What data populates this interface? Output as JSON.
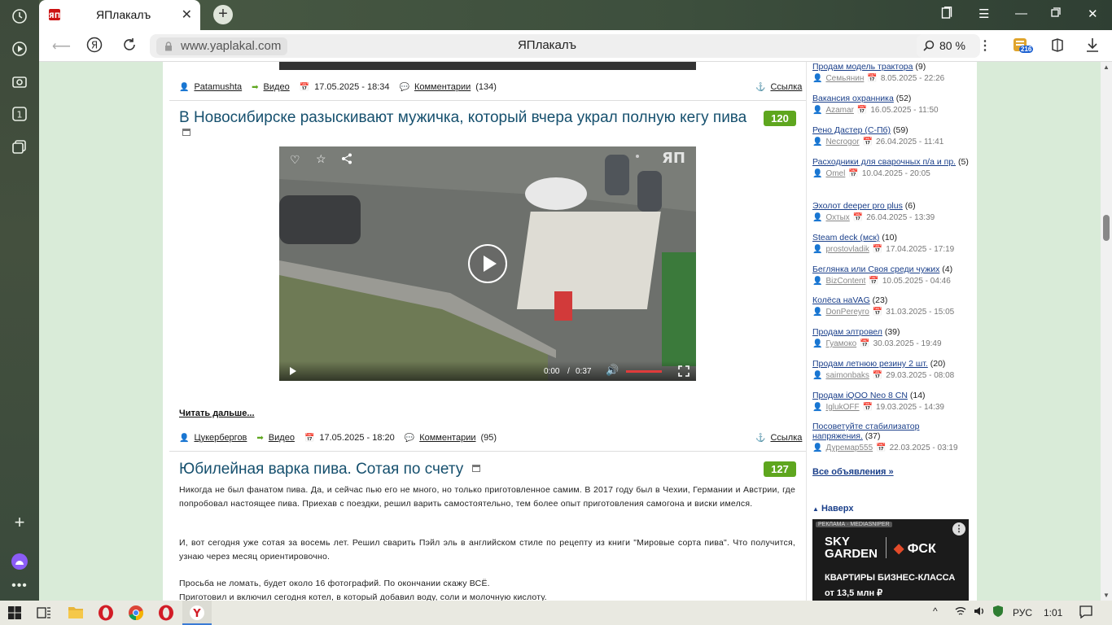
{
  "browser": {
    "tab_title": "ЯПлакалъ",
    "url_host": "www.yaplakal.com",
    "page_title": "ЯПлакалъ",
    "zoom": "80 %",
    "downloads_badge": "216"
  },
  "posts": [
    {
      "meta": {
        "author": "Patamushta",
        "category": "Видео",
        "date": "17.05.2025 - 18:34",
        "comments_label": "Комментарии",
        "comments_count": "(134)",
        "link": "Ссылка"
      }
    },
    {
      "title": "В Новосибирске разыскивают мужичка, который вчера украл полную кегу пива",
      "score": "120",
      "video": {
        "time": "0:00",
        "sep": "/",
        "duration": "0:37"
      },
      "read_more": "Читать дальше...",
      "meta": {
        "author": "Цукербергов",
        "category": "Видео",
        "date": "17.05.2025 - 18:20",
        "comments_label": "Комментарии",
        "comments_count": "(95)",
        "link": "Ссылка"
      }
    },
    {
      "title": "Юбилейная варка пива. Сотая по счету",
      "score": "127",
      "paragraphs": [
        "Никогда не был фанатом пива. Да, и сейчас пью его не много, но только приготовленное самим. В 2017 году был в Чехии, Германии и Австрии, где попробовал настоящее пива. Приехав с поездки, решил варить самостоятельно, тем более опыт приготовления самогона и виски имелся.",
        "И, вот сегодня уже сотая за восемь лет. Решил сварить Пэйл эль в английском стиле по рецепту из книги \"Мировые сорта пива\". Что получится, узнаю через месяц ориентировочно.",
        "Просьба не ломать, будет около 16 фотографий. По окончании скажу ВСЁ.",
        "Приготовил и включил сегодня котел, в который добавил воду, соли и молочную кислоту."
      ]
    }
  ],
  "classifieds": [
    {
      "title": "Продам модель трактора",
      "count": "(9)",
      "user": "Семьянин",
      "date": "8.05.2025 - 22:26"
    },
    {
      "title": "Вакансия охранника",
      "count": "(52)",
      "user": "Azamar",
      "date": "16.05.2025 - 11:50"
    },
    {
      "title": "Рено Дастер (С-Пб)",
      "count": "(59)",
      "user": "Necrogor",
      "date": "26.04.2025 - 11:41"
    },
    {
      "title": "Расходники для сварочных п/а и пр.",
      "count": "(5)",
      "user": "Omel",
      "date": "10.04.2025 - 20:05"
    },
    {
      "title": "Эхолот deeper pro plus",
      "count": "(6)",
      "user": "Охтых",
      "date": "26.04.2025 - 13:39"
    },
    {
      "title": "Steam deck (мск)",
      "count": "(10)",
      "user": "prostovladik",
      "date": "17.04.2025 - 17:19"
    },
    {
      "title": "Беглянка или Своя среди чужих",
      "count": "(4)",
      "user": "BizContent",
      "date": "10.05.2025 - 04:46"
    },
    {
      "title": "Колёса наVAG",
      "count": "(23)",
      "user": "DonPereyro",
      "date": "31.03.2025 - 15:05"
    },
    {
      "title": "Продам элтровел",
      "count": "(39)",
      "user": "Гуамоко",
      "date": "30.03.2025 - 19:49"
    },
    {
      "title": "Продам летнюю резину 2 шт.",
      "count": "(20)",
      "user": "saimonbaks",
      "date": "29.03.2025 - 08:08"
    },
    {
      "title": "Продам iQOO Neo 8 CN",
      "count": "(14)",
      "user": "IglukOFF",
      "date": "19.03.2025 - 14:39"
    },
    {
      "title": "Посоветуйте стабилизатор напряжения.",
      "count": "(37)",
      "user": "Дуремар555",
      "date": "22.03.2025 - 03:19"
    }
  ],
  "all_ads": "Все объявления »",
  "to_top": "Наверх",
  "banner": {
    "label": "РЕКЛАМА · MEDIASNIPER",
    "brand1": "SKY GARDEN",
    "brand2": "ФСК",
    "line1": "КВАРТИРЫ БИЗНЕС-КЛАССА",
    "line2": "от 13,5 млн ₽"
  },
  "taskbar": {
    "lang": "РУС",
    "time": "1:01"
  },
  "colors": {
    "accent_title": "#16506e",
    "score_badge": "#5ea61e",
    "page_bg": "#d9ebd8"
  }
}
